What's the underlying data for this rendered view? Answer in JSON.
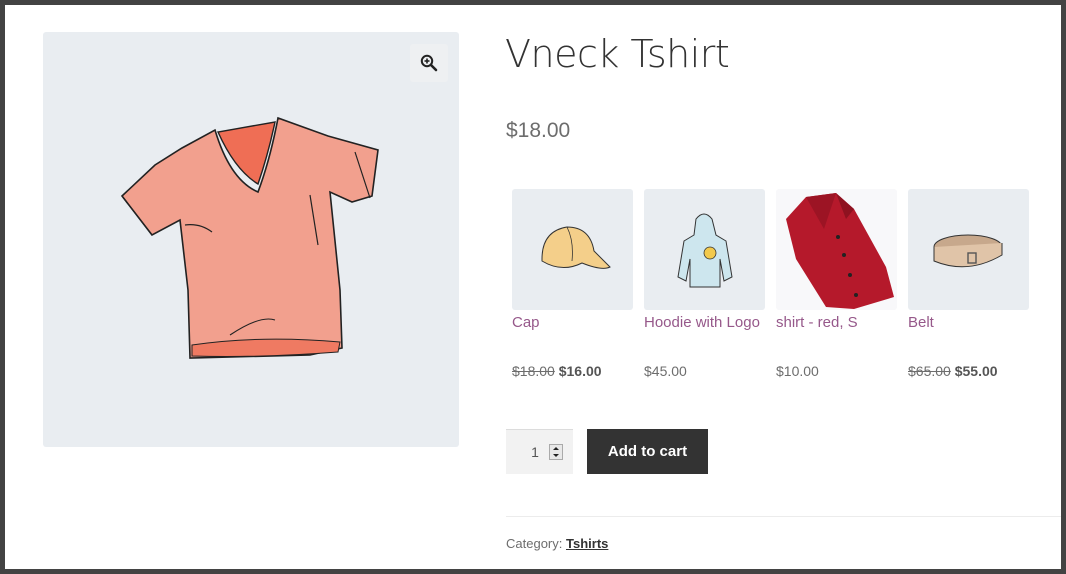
{
  "product": {
    "title": "Vneck Tshirt",
    "price": "$18.00",
    "image_alt": "vneck-tshirt-image",
    "zoom_icon": "zoom-in-magnifier-icon"
  },
  "related": [
    {
      "name": "Cap",
      "old_price": "$18.00",
      "price": "$16.00",
      "on_sale": true,
      "image": "cap"
    },
    {
      "name": "Hoodie with Logo",
      "old_price": "",
      "price": "$45.00",
      "on_sale": false,
      "image": "hoodie"
    },
    {
      "name": "shirt - red, S",
      "old_price": "",
      "price": "$10.00",
      "on_sale": false,
      "image": "red-shirt"
    },
    {
      "name": "Belt",
      "old_price": "$65.00",
      "price": "$55.00",
      "on_sale": true,
      "image": "belt"
    }
  ],
  "cart": {
    "quantity": "1",
    "add_to_cart_label": "Add to cart"
  },
  "meta": {
    "category_label": "Category:",
    "category_value": "Tshirts"
  },
  "colors": {
    "link": "#96588a",
    "button_bg": "#333333",
    "gallery_bg": "#e9edf1",
    "frame": "#434343"
  }
}
